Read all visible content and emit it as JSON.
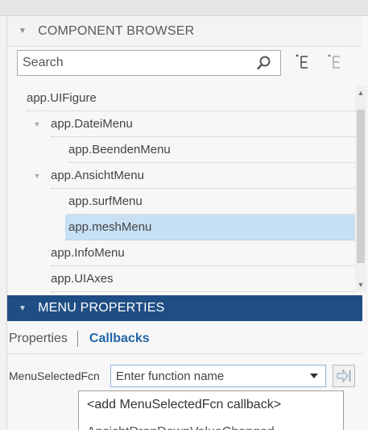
{
  "component_browser": {
    "title": "COMPONENT BROWSER",
    "search_placeholder": "Search",
    "icons": [
      "search-icon",
      "expand-tree-icon",
      "collapse-tree-icon"
    ],
    "tree": [
      {
        "label": "app.UIFigure",
        "level": 0,
        "expandable": false,
        "selected": false
      },
      {
        "label": "app.DateiMenu",
        "level": 1,
        "expandable": true,
        "selected": false
      },
      {
        "label": "app.BeendenMenu",
        "level": 2,
        "expandable": false,
        "selected": false
      },
      {
        "label": "app.AnsichtMenu",
        "level": 1,
        "expandable": true,
        "selected": false
      },
      {
        "label": "app.surfMenu",
        "level": 2,
        "expandable": false,
        "selected": false
      },
      {
        "label": "app.meshMenu",
        "level": 2,
        "expandable": false,
        "selected": true
      },
      {
        "label": "app.InfoMenu",
        "level": 1,
        "expandable": false,
        "selected": false
      },
      {
        "label": "app.UIAxes",
        "level": 1,
        "expandable": false,
        "selected": false
      }
    ]
  },
  "menu_properties": {
    "title": "MENU PROPERTIES",
    "tabs": {
      "properties": "Properties",
      "callbacks": "Callbacks"
    },
    "callback_field": {
      "label": "MenuSelectedFcn",
      "placeholder": "Enter function name"
    },
    "dropdown_options": [
      "<add MenuSelectedFcn callback>",
      "AnsichtDropDownValueChanged"
    ]
  },
  "colors": {
    "header_blue": "#1f4e84",
    "selection": "#c7e0f4",
    "callbacks_tab": "#2165a8"
  }
}
